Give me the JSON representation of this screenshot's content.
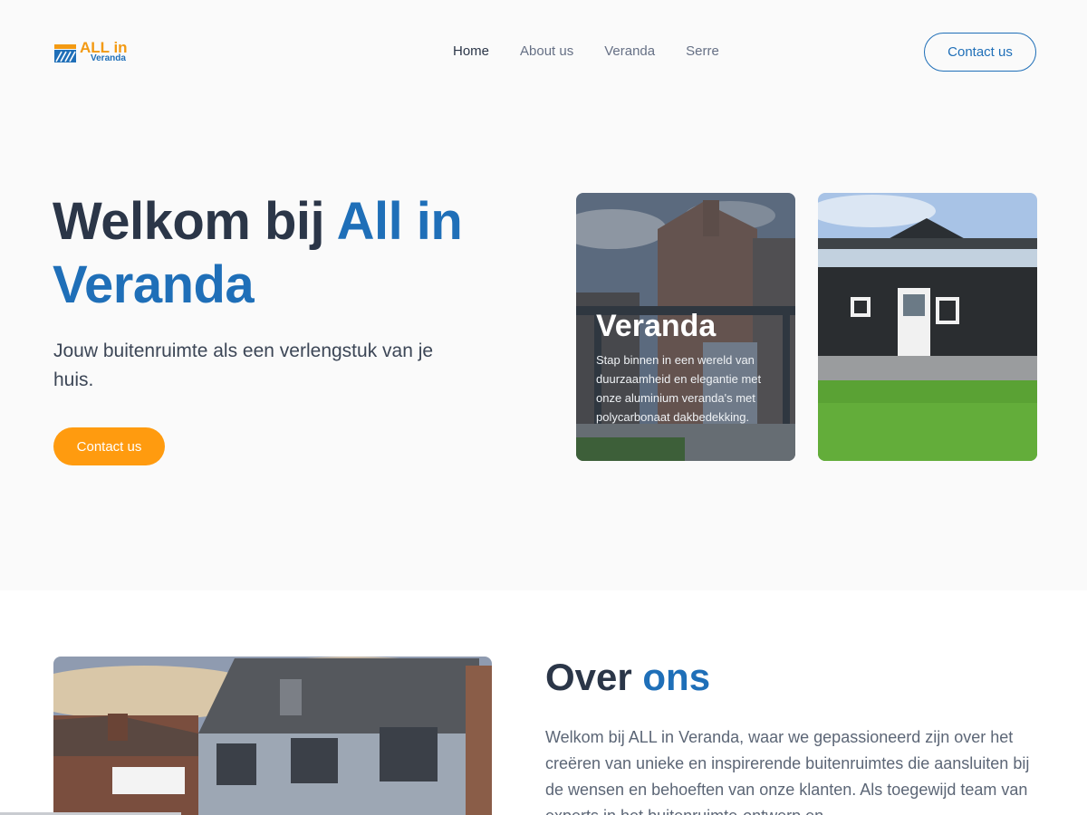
{
  "brand": {
    "logo_text_main": "ALL in",
    "logo_text_sub": "Veranda",
    "colors": {
      "primary": "#1f6fb8",
      "accent": "#ff9b0f",
      "text": "#2b3648"
    }
  },
  "nav": {
    "items": [
      {
        "label": "Home",
        "active": true
      },
      {
        "label": "About us",
        "active": false
      },
      {
        "label": "Veranda",
        "active": false
      },
      {
        "label": "Serre",
        "active": false
      }
    ],
    "cta_label": "Contact us"
  },
  "hero": {
    "title_prefix": "Welkom bij ",
    "title_accent": "All in Veranda",
    "subtitle": "Jouw buitenruimte als een verlengstuk van je huis.",
    "cta_label": "Contact us"
  },
  "cards": {
    "veranda": {
      "title": "Veranda",
      "description": "Stap binnen in een wereld van duurzaamheid en elegantie met onze aluminium veranda's met polycarbonaat dakbedekking."
    }
  },
  "about": {
    "title_prefix": "Over ",
    "title_accent": "ons",
    "text": "Welkom bij ALL in Veranda, waar we gepassioneerd zijn over het creëren van unieke en inspirerende buitenruimtes die aansluiten bij de wensen en behoeften van onze klanten. Als toegewijd team van experts in het buitenruimte-ontwerp en..."
  }
}
